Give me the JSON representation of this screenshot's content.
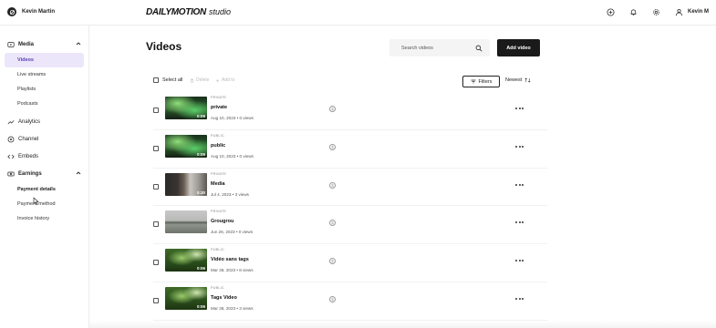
{
  "user": {
    "name": "Kevin Martin"
  },
  "brand": {
    "logo": "DAILYMOTION",
    "suffix": "studio"
  },
  "header": {
    "account_label": "Kevin M"
  },
  "sidebar": {
    "media": {
      "label": "Media",
      "items": [
        {
          "label": "Videos",
          "active": true
        },
        {
          "label": "Live streams"
        },
        {
          "label": "Playlists"
        },
        {
          "label": "Podcasts"
        }
      ]
    },
    "analytics": "Analytics",
    "channel": "Channel",
    "embeds": "Embeds",
    "earnings": {
      "label": "Earnings",
      "items": [
        {
          "label": "Payment details"
        },
        {
          "label": "Payment method"
        },
        {
          "label": "Invoice history"
        }
      ]
    }
  },
  "main": {
    "title": "Videos",
    "search_placeholder": "Search videos",
    "add_button": "Add video",
    "select_all": "Select all",
    "delete_label": "Delete",
    "add_to_label": "Add to",
    "filters_label": "Filters",
    "sort_label": "Newest"
  },
  "videos": [
    {
      "visibility": "PRIVATE",
      "title": "private",
      "meta": "Aug 10, 2023 • 0 views",
      "duration": "0:09",
      "thumb": "aurora"
    },
    {
      "visibility": "PUBLIC",
      "title": "public",
      "meta": "Aug 10, 2023 • 0 views",
      "duration": "0:09",
      "thumb": "aurora"
    },
    {
      "visibility": "PRIVATE",
      "title": "Media",
      "meta": "Jul 4, 2023 • 3 views",
      "duration": "0:30",
      "thumb": "room"
    },
    {
      "visibility": "PRIVATE",
      "title": "Grougrou",
      "meta": "Jun 26, 2023 • 0 views",
      "duration": "",
      "thumb": "lake"
    },
    {
      "visibility": "PUBLIC",
      "title": "Vidéo sans tags",
      "meta": "Mar 28, 2023 • 8 views",
      "duration": "0:06",
      "thumb": "forest"
    },
    {
      "visibility": "PUBLIC",
      "title": "Tags Video",
      "meta": "Mar 28, 2023 • 3 views",
      "duration": "0:06",
      "thumb": "forest"
    }
  ],
  "colors": {
    "accent_active_bg": "#ece6fb",
    "accent_active_text": "#5a3fb0",
    "primary_button": "#1a1a1a"
  }
}
